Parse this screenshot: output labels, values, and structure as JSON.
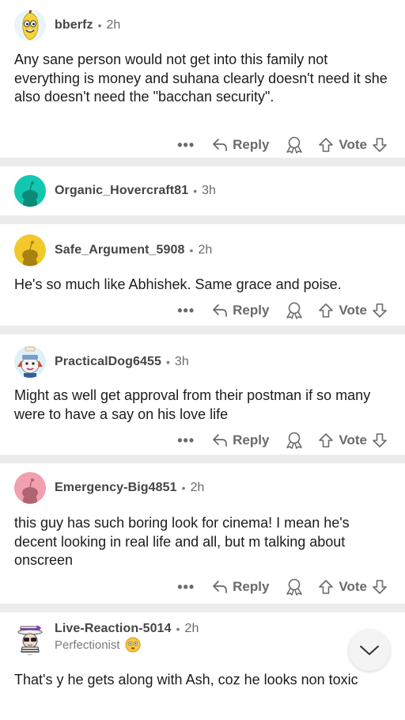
{
  "comments": [
    {
      "username": "bberfz",
      "time": "2h",
      "text": "Any sane person would not get into this family not everything is money and suhana clearly doesn't need it she also doesn't need the \"bacchan security\".",
      "avatar_icon": "banana-avatar-icon"
    },
    {
      "username": "Organic_Hovercraft81",
      "time": "3h",
      "avatar_color": "#12c7b0",
      "avatar_icon": "snoo-avatar-icon"
    },
    {
      "username": "Safe_Argument_5908",
      "time": "2h",
      "text": "He's so much like Abhishek. Same grace and poise.",
      "avatar_color": "#f2c82b",
      "avatar_icon": "snoo-avatar-icon"
    },
    {
      "username": "PracticalDog6455",
      "time": "3h",
      "text": "Might as well get approval from their postman if so many were to have a say on his love life",
      "avatar_icon": "dog-avatar-icon"
    },
    {
      "username": "Emergency-Big4851",
      "time": "2h",
      "text": "this guy has such boring look for cinema! I mean he's decent looking in real life and all, but m talking about onscreen",
      "avatar_color": "#f0a0ae",
      "avatar_icon": "snoo-avatar-icon"
    },
    {
      "username": "Live-Reaction-5014",
      "time": "2h",
      "flair": "Perfectionist",
      "text": "That's y he gets along with Ash, coz he looks non toxic",
      "avatar_icon": "witch-avatar-icon"
    }
  ],
  "actions": {
    "more": "•••",
    "reply": "Reply",
    "vote": "Vote"
  },
  "dot": "•",
  "colors": {
    "separator": "#ececec",
    "meta": "#6a6a6a"
  },
  "scroll_down_icon": "chevron-down-icon"
}
